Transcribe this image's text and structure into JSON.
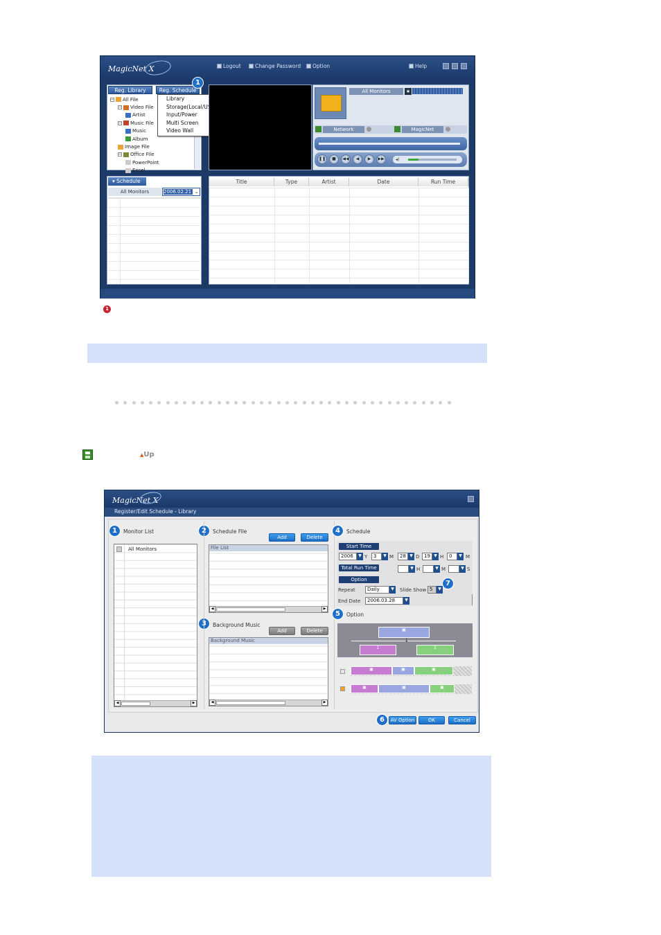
{
  "app1": {
    "logo": "MagicNet X",
    "toplinks": {
      "logout": "Logout",
      "change_password": "Change Password",
      "option": "Option",
      "help": "Help"
    },
    "tabs": {
      "library": "Reg. Library",
      "schedule": "Reg. Schedule"
    },
    "tree": [
      {
        "label": "All File",
        "level": 0
      },
      {
        "label": "Video File",
        "level": 1
      },
      {
        "label": "Artist",
        "level": 2
      },
      {
        "label": "Music File",
        "level": 1
      },
      {
        "label": "Music",
        "level": 2
      },
      {
        "label": "Album",
        "level": 2
      },
      {
        "label": "Image File",
        "level": 1
      },
      {
        "label": "Office File",
        "level": 1
      },
      {
        "label": "PowerPoint",
        "level": 2
      },
      {
        "label": "Excel",
        "level": 2
      }
    ],
    "menu": [
      "Library",
      "Storage(Local/USB)",
      "Input/Power",
      "Multi Screen",
      "Video Wall"
    ],
    "monitor_label": "All Monitors",
    "network_label": "Network",
    "magicnet_label": "MagicNet",
    "schedule_tab": "Schedule",
    "schedule_monitor": "All Monitors",
    "schedule_date": "2006.02.21",
    "columns": [
      "Title",
      "Type",
      "Artist",
      "Date",
      "Run Time"
    ],
    "badge": "1"
  },
  "caption_badge": "1",
  "up_link": "Up",
  "app2": {
    "logo": "MagicNet X",
    "subtitle": "Register/Edit Schedule - Library",
    "monitor_list": {
      "badge": "1",
      "label": "Monitor List",
      "items": [
        "All Monitors"
      ]
    },
    "schedule_file": {
      "badge": "2",
      "label": "Schedule File",
      "add": "Add",
      "delete": "Delete",
      "list_header": "File List"
    },
    "background_music": {
      "badge": "3",
      "label": "Background Music",
      "add": "Add",
      "delete": "Delete",
      "list_header": "Background Music"
    },
    "schedule": {
      "badge": "4",
      "label": "Schedule",
      "start_time": "Start Time",
      "year": "2006",
      "year_unit": "Y",
      "month": "3",
      "month_unit": "M",
      "day": "28",
      "day_unit": "D",
      "hour": "19",
      "hour_unit": "H",
      "minute": "0",
      "minute_unit": "M",
      "total_run_time": "Total Run Time",
      "run_h_unit": "H",
      "run_m_unit": "M",
      "run_s_unit": "S",
      "option": "Option",
      "repeat_label": "Repeat",
      "repeat_value": "Daily",
      "slide_show_label": "Slide Show",
      "slide_show_value": "5",
      "end_date_label": "End Date",
      "end_date_value": "2006.03.28"
    },
    "option": {
      "badge": "5",
      "label": "Option"
    },
    "slide_badge": "7",
    "av_badge": "6",
    "buttons": {
      "av_option": "AV Option",
      "ok": "OK",
      "cancel": "Cancel"
    }
  }
}
